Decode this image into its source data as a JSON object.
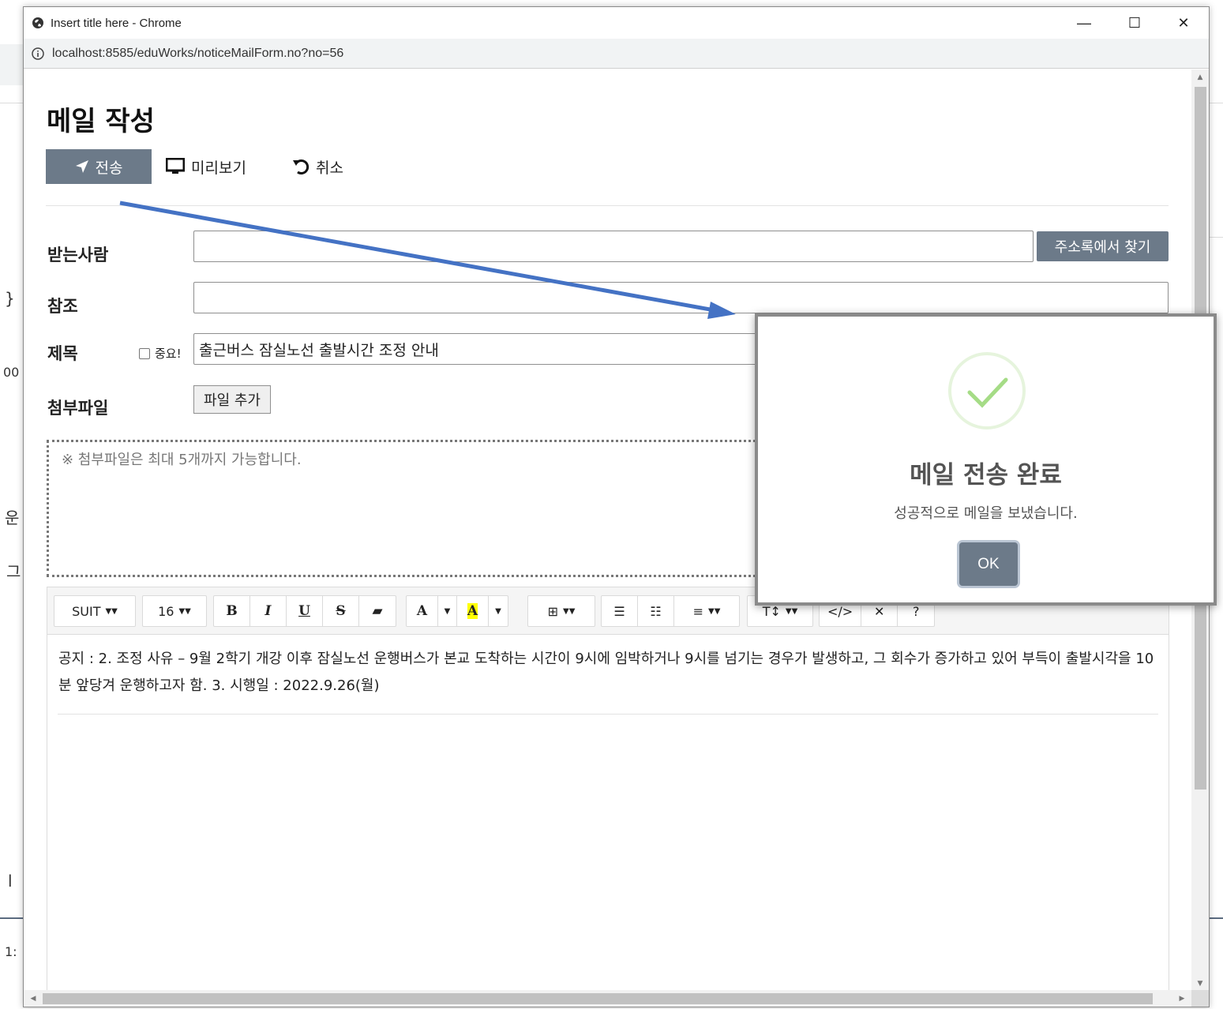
{
  "window": {
    "title": "Insert title here - Chrome",
    "url": "localhost:8585/eduWorks/noticeMailForm.no?no=56",
    "minimize": "—",
    "maximize": "☐",
    "close": "✕"
  },
  "background_fragments": [
    "}",
    "00",
    "운",
    "그",
    "l",
    "1:"
  ],
  "page": {
    "title": "메일 작성",
    "send_label": "전송",
    "preview_label": "미리보기",
    "cancel_label": "취소"
  },
  "form": {
    "to_label": "받는사람",
    "to_value": "",
    "address_book_button": "주소록에서 찾기",
    "cc_label": "참조",
    "cc_value": "",
    "subject_label": "제목",
    "important_label": "중요!",
    "subject_value": "출근버스 잠실노선 출발시간 조정 안내",
    "attach_label": "첨부파일",
    "add_file_button": "파일 추가",
    "attach_hint": "※ 첨부파일은 최대 5개까지 가능합니다."
  },
  "editor": {
    "toolbar": {
      "font_family": "SUIT",
      "font_size": "16",
      "bold": "B",
      "italic": "I",
      "underline": "U",
      "strike": "S",
      "eraser": "▰",
      "font_color": "A",
      "highlight": "A",
      "table": "⊞",
      "bullet_list": "☰",
      "ordered_list": "☷",
      "align": "≡",
      "line_height": "T↕",
      "code_view": "</>",
      "fullscreen": "✕",
      "help": "?"
    },
    "body": "공지 : 2. 조정 사유 – 9월 2학기 개강 이후 잠실노선 운행버스가 본교 도착하는 시간이 9시에 임박하거나 9시를 넘기는 경우가 발생하고, 그 회수가 증가하고 있어 부득이 출발시각을 10분 앞당겨 운행하고자 함. 3. 시행일 : 2022.9.26(월)"
  },
  "modal": {
    "title": "메일 전송 완료",
    "text": "성공적으로 메일을 보냈습니다.",
    "ok": "OK"
  },
  "colors": {
    "primary_button": "#6c7a89",
    "success_icon": "#a5dc86",
    "arrow": "#4472c4"
  }
}
